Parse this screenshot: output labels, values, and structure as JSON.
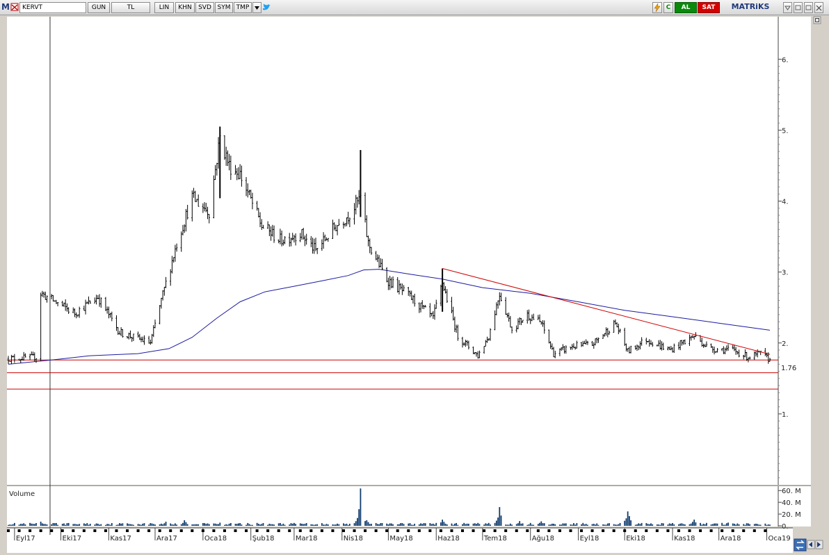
{
  "toolbar": {
    "app_logo": "M",
    "symbol": "KERVT",
    "buttons": [
      "GUN",
      "TL",
      "LIN",
      "KHN",
      "SVD",
      "SYM",
      "TMP"
    ],
    "refresh_label": "C",
    "buy_label": "AL",
    "sell_label": "SAT",
    "brand": "MATRiKS",
    "icons": [
      "dropdown-arrow-icon",
      "twitter-icon",
      "lightning-icon",
      "minimize-icon",
      "restore-icon",
      "close-icon"
    ],
    "colors": {
      "buy": "#0a8a0a",
      "sell": "#d40000",
      "brand": "#1f3a7a"
    }
  },
  "chart": {
    "price_axis_labels": [
      "6.",
      "5.",
      "4.",
      "3.",
      "2.",
      "1."
    ],
    "last_price_label": "1.76",
    "volume_title": "Volume",
    "volume_axis_labels": [
      "60. M",
      "40. M",
      "20. M",
      "0."
    ],
    "month_labels": [
      "Eyl17",
      "Eki17",
      "Kas17",
      "Ara17",
      "Oca18",
      "Şub18",
      "Mar18",
      "Nis18",
      "May18",
      "Haz18",
      "Tem18",
      "Ağu18",
      "Eyl18",
      "Eki18",
      "Kas18",
      "Ara18",
      "Oca19"
    ],
    "colors": {
      "candle": "#000000",
      "moving_average": "#1a1aa0",
      "trend_line": "#d00000",
      "support_line": "#cc0000",
      "volume": "#0f3c6e"
    }
  },
  "chart_data": {
    "type": "candlestick",
    "symbol": "KERVT",
    "x_start": "2017-08-28",
    "x_end": "2019-01-03",
    "ylim": [
      0.0,
      6.6
    ],
    "price_ticks": [
      1,
      2,
      3,
      4,
      5,
      6
    ],
    "last_price": 1.76,
    "close_path": [
      [
        "2017-08-28",
        1.78
      ],
      [
        "2017-09-15",
        1.8
      ],
      [
        "2017-09-18",
        2.7
      ],
      [
        "2017-10-10",
        2.42
      ],
      [
        "2017-10-25",
        2.65
      ],
      [
        "2017-11-08",
        2.15
      ],
      [
        "2017-11-28",
        2.0
      ],
      [
        "2017-12-05",
        2.6
      ],
      [
        "2017-12-15",
        3.4
      ],
      [
        "2017-12-25",
        4.05
      ],
      [
        "2018-01-05",
        3.85
      ],
      [
        "2018-01-12",
        4.9
      ],
      [
        "2018-01-18",
        4.5
      ],
      [
        "2018-01-25",
        4.38
      ],
      [
        "2018-02-08",
        3.65
      ],
      [
        "2018-02-20",
        3.45
      ],
      [
        "2018-03-05",
        3.55
      ],
      [
        "2018-03-15",
        3.3
      ],
      [
        "2018-03-28",
        3.65
      ],
      [
        "2018-04-06",
        3.82
      ],
      [
        "2018-04-13",
        4.05
      ],
      [
        "2018-04-18",
        3.4
      ],
      [
        "2018-04-30",
        2.9
      ],
      [
        "2018-05-15",
        2.65
      ],
      [
        "2018-05-30",
        2.35
      ],
      [
        "2018-06-05",
        2.85
      ],
      [
        "2018-06-15",
        2.1
      ],
      [
        "2018-06-28",
        1.82
      ],
      [
        "2018-07-05",
        2.1
      ],
      [
        "2018-07-12",
        2.7
      ],
      [
        "2018-07-20",
        2.2
      ],
      [
        "2018-07-30",
        2.4
      ],
      [
        "2018-08-08",
        2.28
      ],
      [
        "2018-08-16",
        1.85
      ],
      [
        "2018-08-28",
        1.95
      ],
      [
        "2018-09-10",
        1.98
      ],
      [
        "2018-09-25",
        2.28
      ],
      [
        "2018-10-03",
        1.88
      ],
      [
        "2018-10-15",
        2.05
      ],
      [
        "2018-10-30",
        1.9
      ],
      [
        "2018-11-15",
        2.1
      ],
      [
        "2018-11-25",
        1.92
      ],
      [
        "2018-12-10",
        1.9
      ],
      [
        "2018-12-20",
        1.8
      ],
      [
        "2018-12-28",
        1.85
      ],
      [
        "2019-01-03",
        1.76
      ]
    ],
    "spikes": [
      {
        "date": "2018-04-13",
        "high": 4.72
      },
      {
        "date": "2018-01-12",
        "high": 5.05
      },
      {
        "date": "2018-06-05",
        "high": 3.05
      }
    ],
    "moving_average": [
      [
        "2017-08-28",
        1.7
      ],
      [
        "2017-09-25",
        1.76
      ],
      [
        "2017-10-20",
        1.82
      ],
      [
        "2017-11-20",
        1.85
      ],
      [
        "2017-12-10",
        1.92
      ],
      [
        "2017-12-25",
        2.08
      ],
      [
        "2018-01-10",
        2.35
      ],
      [
        "2018-01-25",
        2.58
      ],
      [
        "2018-02-10",
        2.72
      ],
      [
        "2018-03-01",
        2.8
      ],
      [
        "2018-03-20",
        2.88
      ],
      [
        "2018-04-05",
        2.95
      ],
      [
        "2018-04-15",
        3.03
      ],
      [
        "2018-04-25",
        3.04
      ],
      [
        "2018-05-15",
        2.97
      ],
      [
        "2018-06-05",
        2.9
      ],
      [
        "2018-07-01",
        2.78
      ],
      [
        "2018-08-01",
        2.7
      ],
      [
        "2018-09-01",
        2.58
      ],
      [
        "2018-10-01",
        2.46
      ],
      [
        "2018-11-01",
        2.37
      ],
      [
        "2018-12-01",
        2.28
      ],
      [
        "2019-01-03",
        2.18
      ]
    ],
    "trend_line": {
      "from": [
        "2018-06-05",
        3.05
      ],
      "to": [
        "2019-01-03",
        1.84
      ]
    },
    "horizontal_lines": [
      1.76,
      1.58,
      1.35
    ],
    "cursor_date": "2017-09-24",
    "volume": {
      "unit": "M",
      "ylim": [
        0,
        65
      ],
      "ticks": [
        0,
        20,
        40,
        60
      ],
      "peaks": [
        [
          "2017-09-18",
          8
        ],
        [
          "2017-12-08",
          10
        ],
        [
          "2017-12-20",
          12
        ],
        [
          "2018-01-12",
          7
        ],
        [
          "2018-04-13",
          64
        ],
        [
          "2018-04-17",
          12
        ],
        [
          "2018-06-05",
          14
        ],
        [
          "2018-07-12",
          34
        ],
        [
          "2018-07-25",
          9
        ],
        [
          "2018-08-08",
          10
        ],
        [
          "2018-10-03",
          33
        ],
        [
          "2018-11-15",
          14
        ],
        [
          "2018-12-07",
          6
        ]
      ]
    }
  }
}
